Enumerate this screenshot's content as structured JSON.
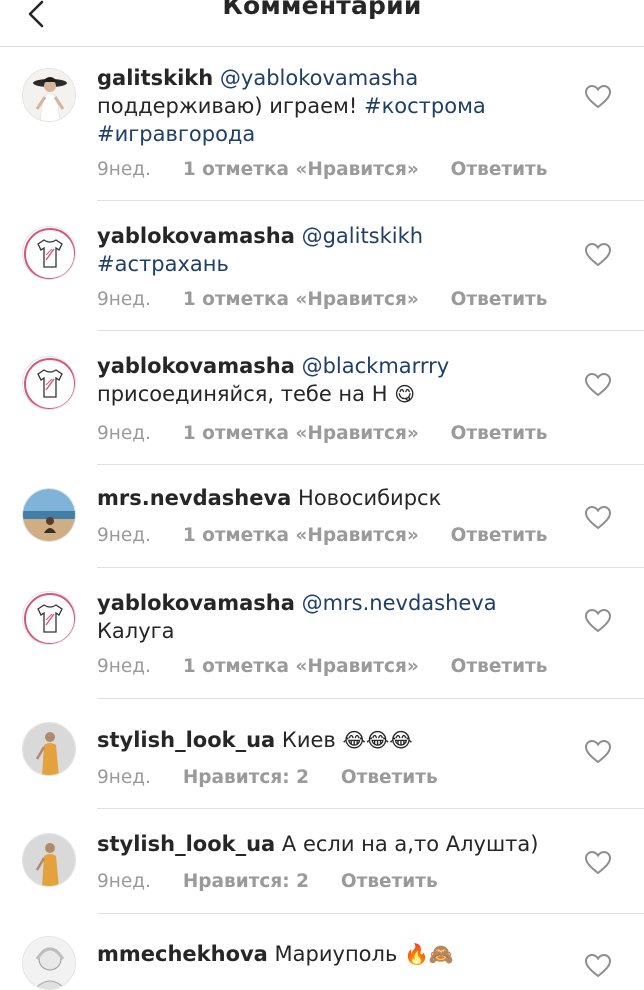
{
  "header": {
    "title": "Комментарии"
  },
  "comments": [
    {
      "username": "galitskikh",
      "mention": "@yablokovamasha",
      "text": "поддерживаю) играем!",
      "hashtag1": "#кострома",
      "hashtag2": "#игравгорода",
      "time": "9нед.",
      "likes": "1 отметка «Нравится»",
      "reply": "Ответить"
    },
    {
      "username": "yablokovamasha",
      "mention": "@galitskikh",
      "hashtag1": "#астрахань",
      "time": "9нед.",
      "likes": "1 отметка «Нравится»",
      "reply": "Ответить"
    },
    {
      "username": "yablokovamasha",
      "mention": "@blackmarrry",
      "text": "присоединяйся, тебе на Н",
      "emoji": "😋",
      "time": "9нед.",
      "likes": "1 отметка «Нравится»",
      "reply": "Ответить"
    },
    {
      "username": "mrs.nevdasheva",
      "text": "Новосибирск",
      "time": "9нед.",
      "likes": "1 отметка «Нравится»",
      "reply": "Ответить"
    },
    {
      "username": "yablokovamasha",
      "mention": "@mrs.nevdasheva",
      "text": "Калуга",
      "time": "9нед.",
      "likes": "1 отметка «Нравится»",
      "reply": "Ответить"
    },
    {
      "username": "stylish_look_ua",
      "text": "Киев",
      "emoji": "😂😂😂",
      "time": "9нед.",
      "likes": "Нравится: 2",
      "reply": "Ответить"
    },
    {
      "username": "stylish_look_ua",
      "text": "А если на а,то Алушта)",
      "time": "9нед.",
      "likes": "Нравится: 2",
      "reply": "Ответить"
    },
    {
      "username": "mmechekhova",
      "text": "Мариуполь",
      "emoji": "🔥🙈"
    }
  ],
  "icons": {
    "back": "chevron-left-icon",
    "like": "heart-outline-icon",
    "avatar_tshirt": "tshirt-logo-icon"
  },
  "colors": {
    "link": "#1e3f66",
    "meta": "#9a9a9a",
    "divider": "#e0e0e0",
    "brand_pink": "#d6567a"
  }
}
